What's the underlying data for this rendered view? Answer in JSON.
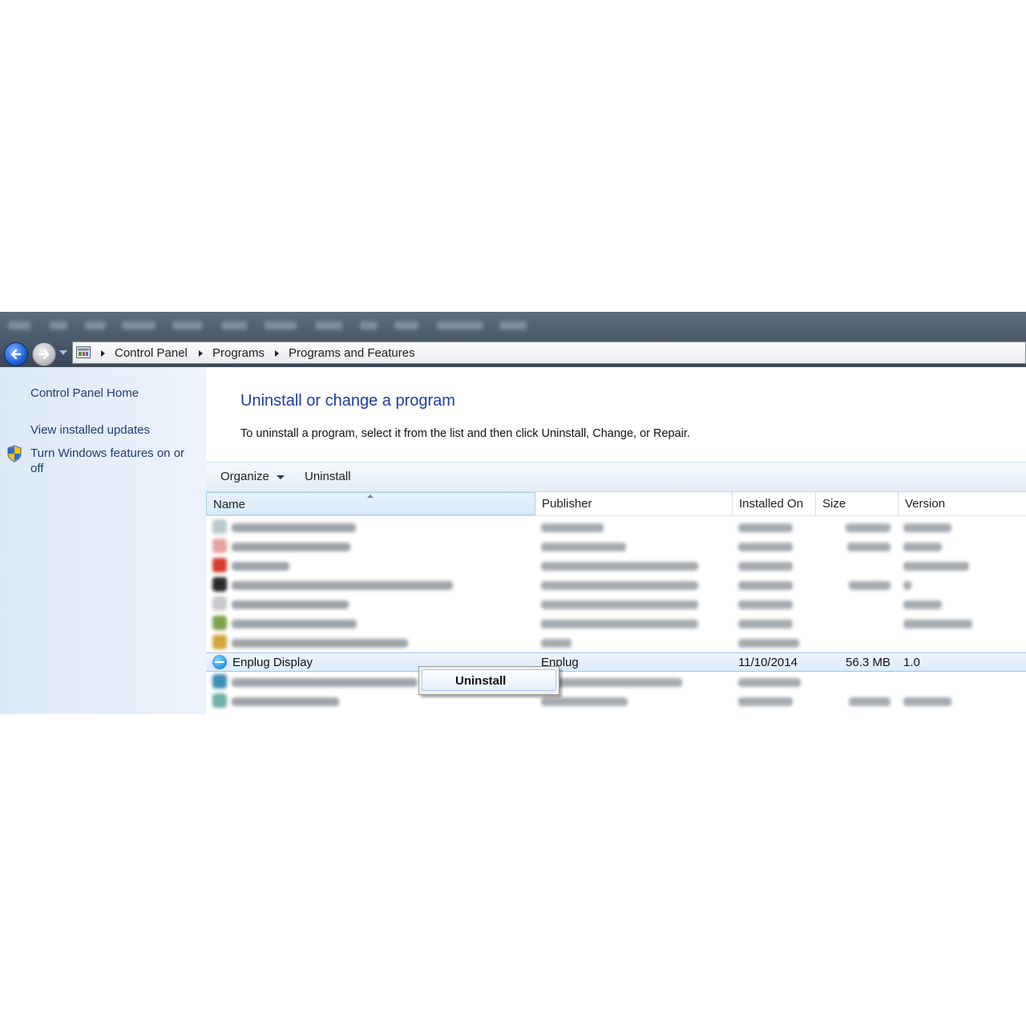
{
  "breadcrumb": [
    "Control Panel",
    "Programs",
    "Programs and Features"
  ],
  "left_pane": {
    "home": "Control Panel Home",
    "updates": "View installed updates",
    "features_line1": "Turn Windows features on or",
    "features_line2": "off"
  },
  "main": {
    "title": "Uninstall or change a program",
    "description": "To uninstall a program, select it from the list and then click Uninstall, Change, or Repair."
  },
  "toolbar": {
    "organize": "Organize",
    "uninstall": "Uninstall"
  },
  "columns": [
    "Name",
    "Publisher",
    "Installed On",
    "Size",
    "Version"
  ],
  "selected_program": {
    "name": "Enplug Display",
    "publisher": "Enplug",
    "installed_on": "11/10/2014",
    "size": "56.3 MB",
    "version": "1.0"
  },
  "context_menu": {
    "item": "Uninstall"
  },
  "colors": {
    "title_blue": "#1e3c9c",
    "link_blue": "#1e3c77",
    "selection": "#dcebfc"
  }
}
